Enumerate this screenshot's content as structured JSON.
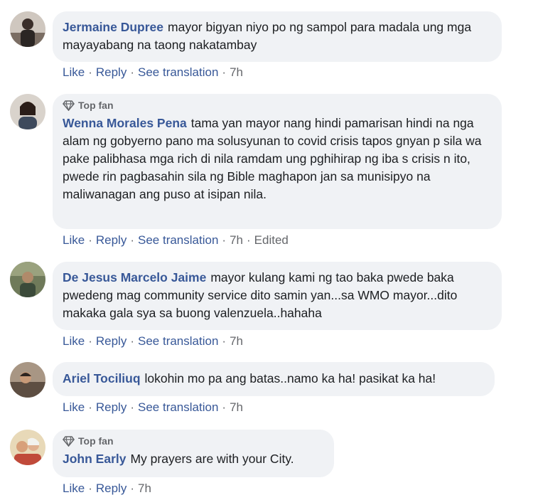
{
  "comments": [
    {
      "author": "Jermaine Dupree",
      "text": "mayor bigyan niyo po ng sampol para madala ung mga mayayabang na taong nakatambay",
      "top_fan": false,
      "actions": {
        "like": "Like",
        "reply": "Reply",
        "translate": "See translation",
        "time": "7h"
      },
      "avatar_icon": "profile-photo"
    },
    {
      "author": "Wenna Morales Pena",
      "badge": "Top fan",
      "text": "tama yan mayor nang hindi pamarisan hindi na nga alam ng gobyerno pano ma solusyunan to covid crisis tapos gnyan p sila wa pake palibhasa mga rich di nila ramdam ung pghihirap ng iba s crisis n ito, pwede rin pagbasahin sila ng Bible maghapon jan sa munisipyo na maliwanagan ang puso at isipan nila.",
      "top_fan": true,
      "actions": {
        "like": "Like",
        "reply": "Reply",
        "translate": "See translation",
        "time": "7h",
        "edited": "Edited"
      },
      "avatar_icon": "profile-photo"
    },
    {
      "author": "De Jesus Marcelo Jaime",
      "text": "mayor kulang kami ng tao baka pwede baka pwedeng mag community service dito samin yan...sa WMO mayor...dito makaka gala sya sa buong valenzuela..hahaha",
      "top_fan": false,
      "actions": {
        "like": "Like",
        "reply": "Reply",
        "translate": "See translation",
        "time": "7h"
      },
      "avatar_icon": "profile-photo"
    },
    {
      "author": "Ariel Tociliuq",
      "text": "lokohin mo pa ang batas..namo ka ha! pasikat ka ha!",
      "top_fan": false,
      "actions": {
        "like": "Like",
        "reply": "Reply",
        "translate": "See translation",
        "time": "7h"
      },
      "avatar_icon": "profile-photo"
    },
    {
      "author": "John Early",
      "badge": "Top fan",
      "text": "My prayers are with your City.",
      "top_fan": true,
      "actions": {
        "like": "Like",
        "reply": "Reply",
        "time": "7h"
      },
      "avatar_icon": "profile-photo"
    }
  ],
  "separator": "·",
  "colors": {
    "link": "#385898",
    "meta": "#65676b",
    "bubble": "#f0f2f5",
    "text": "#1c1e21"
  }
}
